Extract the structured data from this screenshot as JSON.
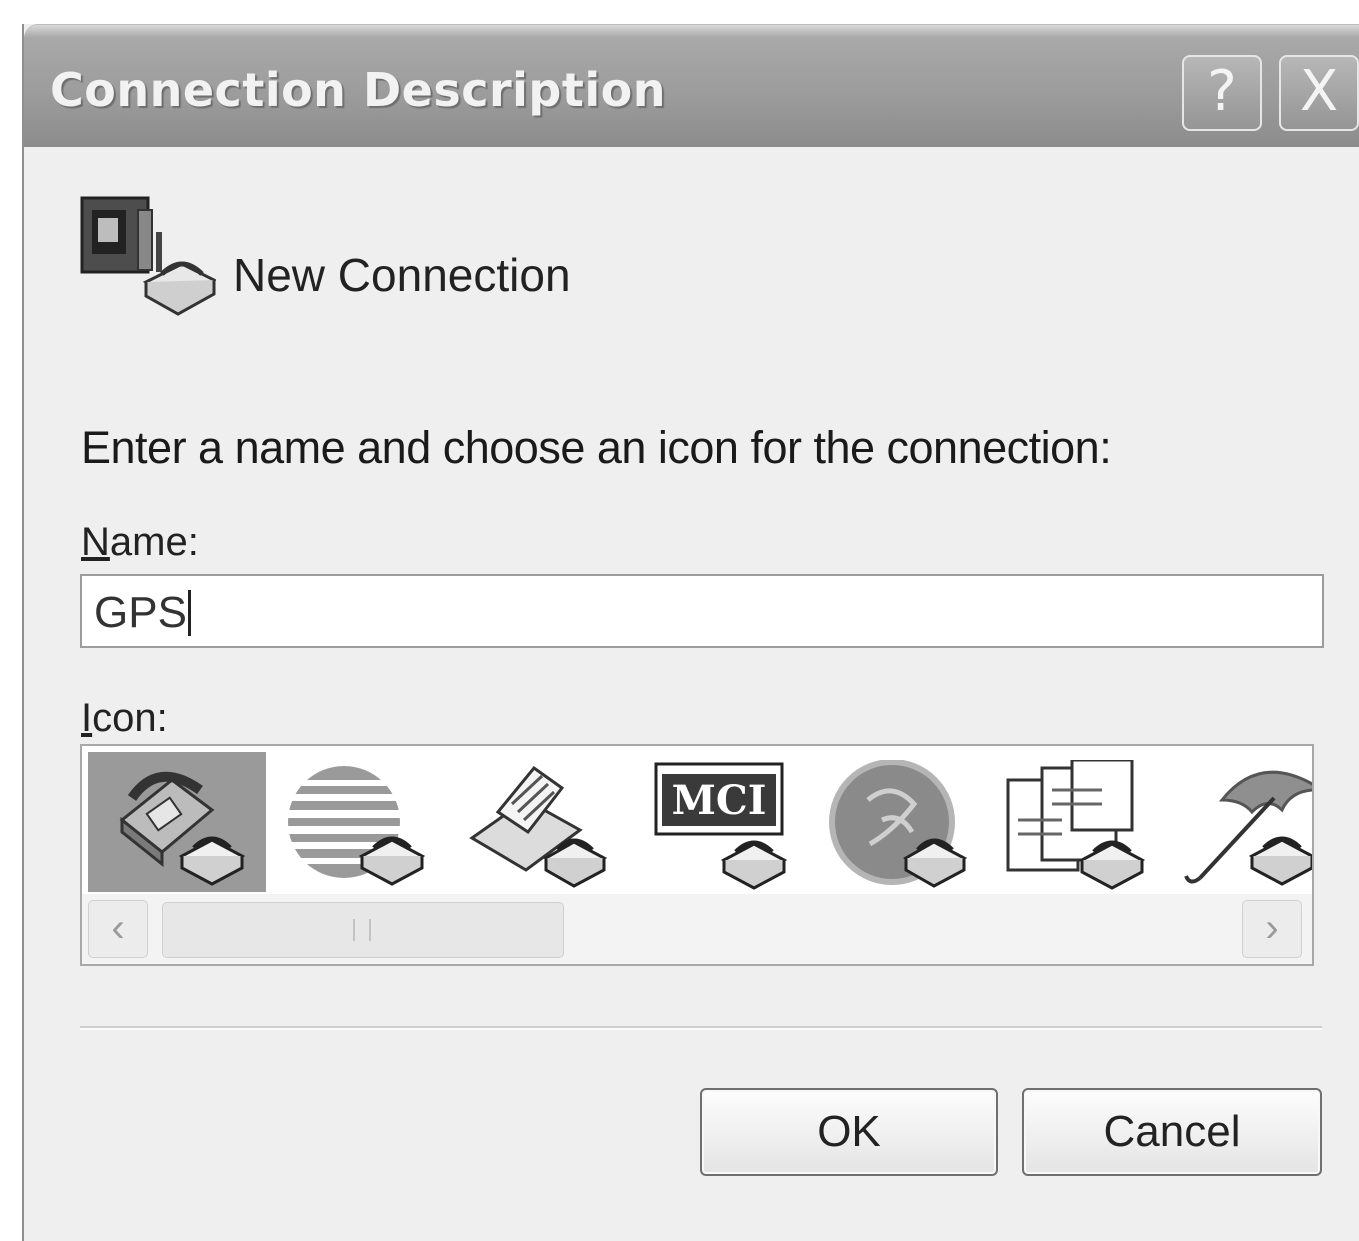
{
  "window": {
    "title": "Connection Description",
    "help_button": "?",
    "close_button": "X"
  },
  "header": {
    "icon": "phone-connection-icon",
    "title": "New Connection"
  },
  "form": {
    "prompt": "Enter a name and choose an icon for the connection:",
    "name_label_mnemonic": "N",
    "name_label_rest": "ame:",
    "name_value": "GPS",
    "icon_label_mnemonic": "I",
    "icon_label_rest": "con:"
  },
  "icons": [
    {
      "name": "telephone-connection-icon",
      "selected": true
    },
    {
      "name": "globe-stripes-connection-icon",
      "selected": false
    },
    {
      "name": "fax-machine-connection-icon",
      "selected": false
    },
    {
      "name": "mci-connection-icon",
      "label": "MCI",
      "selected": false
    },
    {
      "name": "ge-globe-connection-icon",
      "selected": false
    },
    {
      "name": "documents-connection-icon",
      "selected": false
    },
    {
      "name": "umbrella-connection-icon",
      "selected": false
    }
  ],
  "scrollbar": {
    "left_arrow": "‹",
    "right_arrow": "›"
  },
  "buttons": {
    "ok": "OK",
    "cancel": "Cancel"
  }
}
